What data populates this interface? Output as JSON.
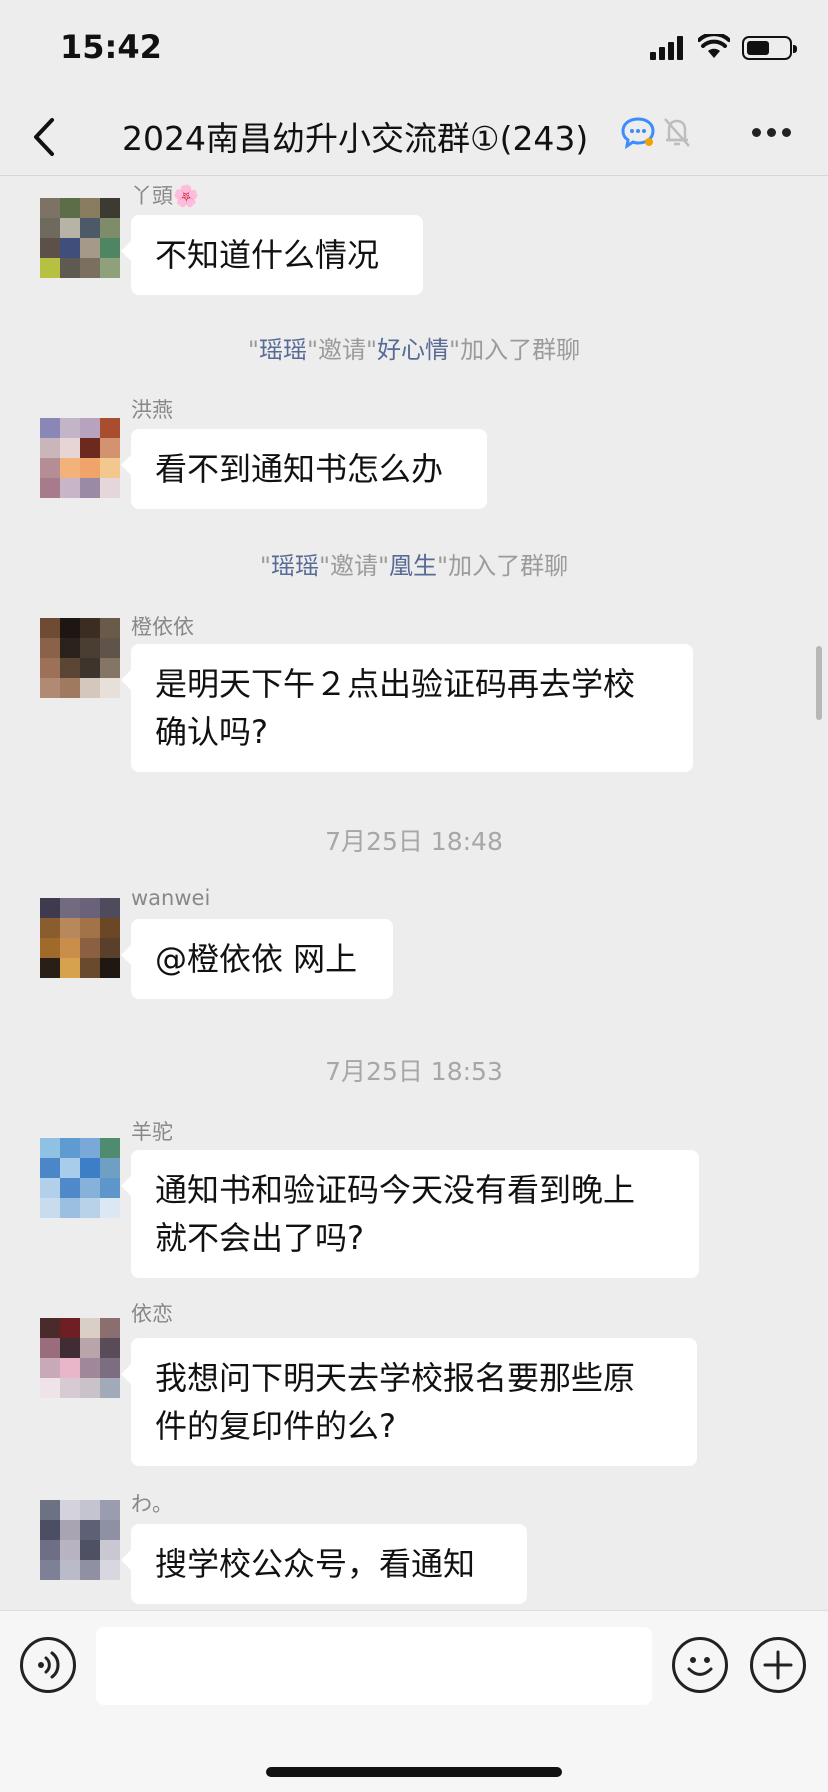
{
  "status_bar": {
    "time": "15:42"
  },
  "header": {
    "title": "2024南昌幼升小交流群①(243)"
  },
  "messages": [
    {
      "sender": "丫頭🌸",
      "text": "不知道什么情况"
    },
    {
      "sender": "洪燕",
      "text": "看不到通知书怎么办"
    },
    {
      "sender": "橙依依",
      "line1": "是明天下午２点出验证码再去学校",
      "line2": "确认吗?"
    },
    {
      "sender": "wanwei",
      "text": "@橙依依 网上"
    },
    {
      "sender": "羊驼",
      "line1": "通知书和验证码今天没有看到晚上",
      "line2": "就不会出了吗?"
    },
    {
      "sender": "依恋",
      "line1": "我想问下明天去学校报名要那些原",
      "line2": "件的复印件的么?"
    },
    {
      "sender": "わ。",
      "text": "搜学校公众号，看通知"
    }
  ],
  "system_notices": [
    {
      "inviter": "瑶瑶",
      "verb": "邀请",
      "invitee": "好心情",
      "suffix": "加入了群聊"
    },
    {
      "inviter": "瑶瑶",
      "verb": "邀请",
      "invitee": "凰生",
      "suffix": "加入了群聊"
    }
  ],
  "timestamps": [
    "7月25日 18:48",
    "7月25日 18:53"
  ],
  "icons": {
    "back": "chevron-left-icon",
    "chat": "chat-bubble-icon",
    "mute": "bell-slash-icon",
    "more": "more-icon",
    "voice": "voice-icon",
    "emoji": "emoji-icon",
    "plus": "plus-icon"
  },
  "colors": {
    "background": "#ededed",
    "bubble": "#ffffff",
    "system_name": "#576b95",
    "system_text": "#9b9b9b"
  }
}
